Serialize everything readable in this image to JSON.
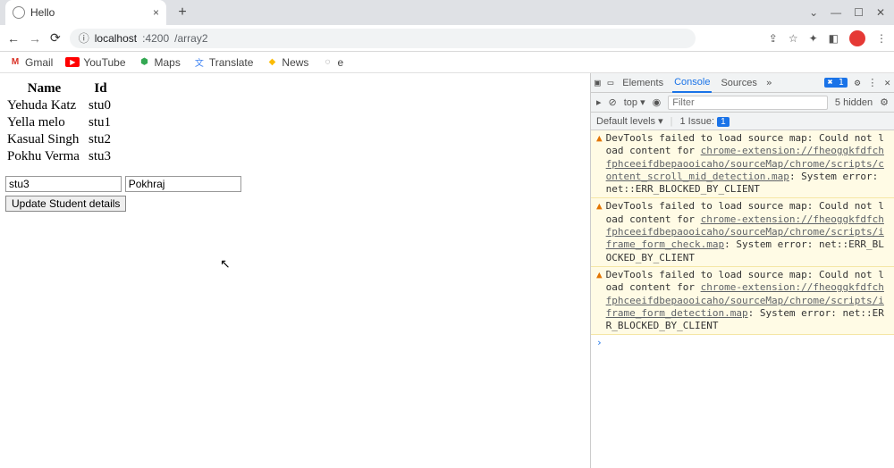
{
  "browser": {
    "tab_title": "Hello",
    "url_host": "localhost",
    "url_port": ":4200",
    "url_path": "/array2"
  },
  "bookmarks": [
    "Gmail",
    "YouTube",
    "Maps",
    "Translate",
    "News",
    "e"
  ],
  "table": {
    "headers": [
      "Name",
      "Id"
    ],
    "rows": [
      {
        "name": "Yehuda Katz",
        "id": "stu0"
      },
      {
        "name": "Yella melo",
        "id": "stu1"
      },
      {
        "name": "Kasual Singh",
        "id": "stu2"
      },
      {
        "name": "Pokhu Verma",
        "id": "stu3"
      }
    ]
  },
  "form": {
    "input1_value": "stu3",
    "input2_value": "Pokhraj",
    "button_label": "Update Student details"
  },
  "devtools": {
    "tabs": [
      "Elements",
      "Console",
      "Sources"
    ],
    "active_tab": "Console",
    "errors_badge": "1",
    "top_label": "top",
    "filter_placeholder": "Filter",
    "hidden_text": "5 hidden",
    "levels_label": "Default levels",
    "issue_label": "1 Issue:",
    "issue_badge": "1",
    "warnings": [
      {
        "prefix": "DevTools failed to load source map: Could not load content for ",
        "link": "chrome-extension://fheoggkfdfchfphceeifdbepaooicaho/sourceMap/chrome/scripts/content_scroll_mid_detection.map",
        "suffix": ": System error: net::ERR_BLOCKED_BY_CLIENT"
      },
      {
        "prefix": "DevTools failed to load source map: Could not load content for ",
        "link": "chrome-extension://fheoggkfdfchfphceeifdbepaooicaho/sourceMap/chrome/scripts/iframe_form_check.map",
        "suffix": ": System error: net::ERR_BLOCKED_BY_CLIENT"
      },
      {
        "prefix": "DevTools failed to load source map: Could not load content for ",
        "link": "chrome-extension://fheoggkfdfchfphceeifdbepaooicaho/sourceMap/chrome/scripts/iframe_form_detection.map",
        "suffix": ": System error: net::ERR_BLOCKED_BY_CLIENT"
      }
    ]
  }
}
